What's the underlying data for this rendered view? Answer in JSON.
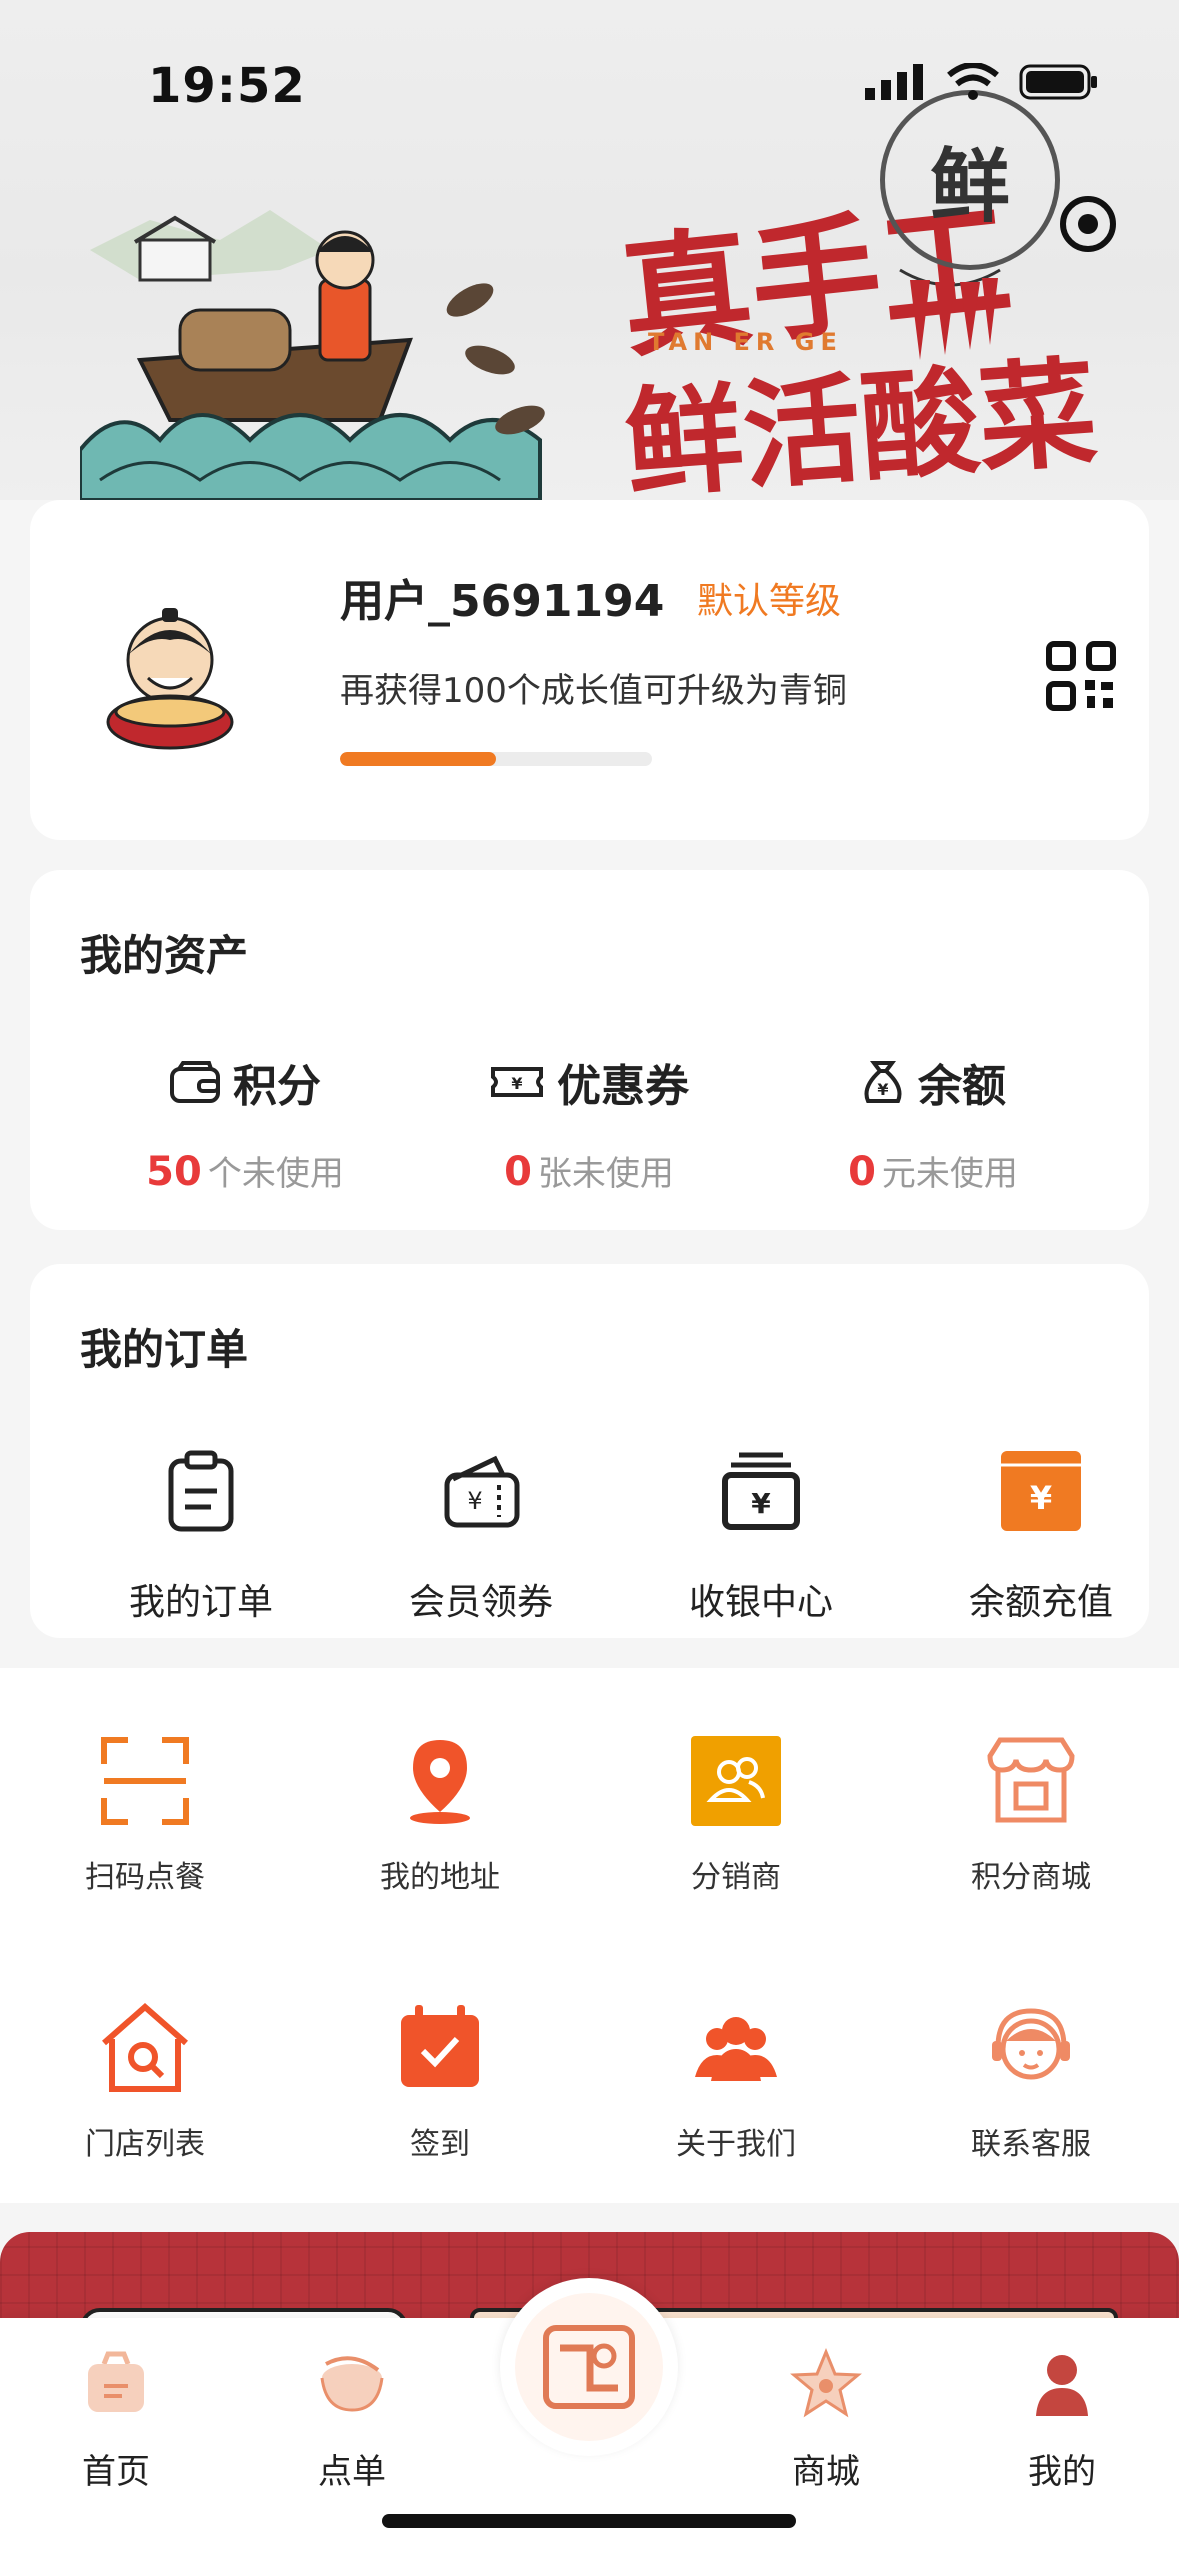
{
  "status": {
    "time": "19:52"
  },
  "banner": {
    "slogan_line1": "真手工",
    "slogan_line2": "鲜活酸菜鱼",
    "brand_en": "TAN ER GE",
    "logo_char": "鲜"
  },
  "user": {
    "name": "用户_5691194",
    "level": "默认等级",
    "growth_text": "再获得100个成长值可升级为青铜",
    "progress": 0.5
  },
  "assets": {
    "title": "我的资产",
    "items": [
      {
        "label": "积分",
        "value": "50",
        "unit": "个未使用",
        "icon": "wallet-icon"
      },
      {
        "label": "优惠券",
        "value": "0",
        "unit": "张未使用",
        "icon": "ticket-icon"
      },
      {
        "label": "余额",
        "value": "0",
        "unit": "元未使用",
        "icon": "money-bag-icon"
      }
    ]
  },
  "orders": {
    "title": "我的订单",
    "items": [
      {
        "label": "我的订单",
        "icon": "clipboard-icon"
      },
      {
        "label": "会员领券",
        "icon": "coupon-wallet-icon"
      },
      {
        "label": "收银中心",
        "icon": "cashier-icon"
      },
      {
        "label": "余额充值",
        "icon": "recharge-icon"
      }
    ]
  },
  "tools": [
    {
      "label": "扫码点餐",
      "icon": "scan-icon"
    },
    {
      "label": "我的地址",
      "icon": "location-pin-icon"
    },
    {
      "label": "分销商",
      "icon": "distributor-icon"
    },
    {
      "label": "积分商城",
      "icon": "store-icon"
    },
    {
      "label": "门店列表",
      "icon": "store-search-icon"
    },
    {
      "label": "签到",
      "icon": "calendar-check-icon"
    },
    {
      "label": "关于我们",
      "icon": "group-icon"
    },
    {
      "label": "联系客服",
      "icon": "customer-service-icon"
    }
  ],
  "tabbar": {
    "items": [
      {
        "label": "首页",
        "icon": "home-bag-icon"
      },
      {
        "label": "点单",
        "icon": "bowl-icon"
      },
      {
        "label": "商城",
        "icon": "star-icon"
      },
      {
        "label": "我的",
        "icon": "profile-icon"
      }
    ]
  },
  "colors": {
    "accent": "#f07a22",
    "brand_red": "#c0282d",
    "price_red": "#e83a3a"
  }
}
